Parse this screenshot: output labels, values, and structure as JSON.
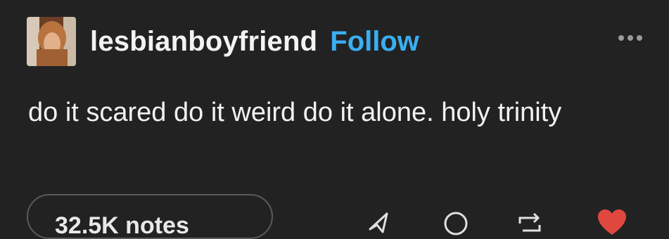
{
  "post": {
    "username": "lesbianboyfriend",
    "follow_label": "Follow",
    "text": "do it scared do it weird do it alone. holy trinity",
    "notes_label": "32.5K notes"
  },
  "icons": {
    "avatar": "avatar-image",
    "more": "more-dots-icon",
    "share": "share-icon",
    "reply": "reply-icon",
    "reblog": "reblog-icon",
    "like": "heart-icon"
  },
  "colors": {
    "background": "#222223",
    "text": "#f2f2f2",
    "follow": "#3aaef0",
    "muted": "#9a9a9a",
    "heart": "#e0483f"
  }
}
